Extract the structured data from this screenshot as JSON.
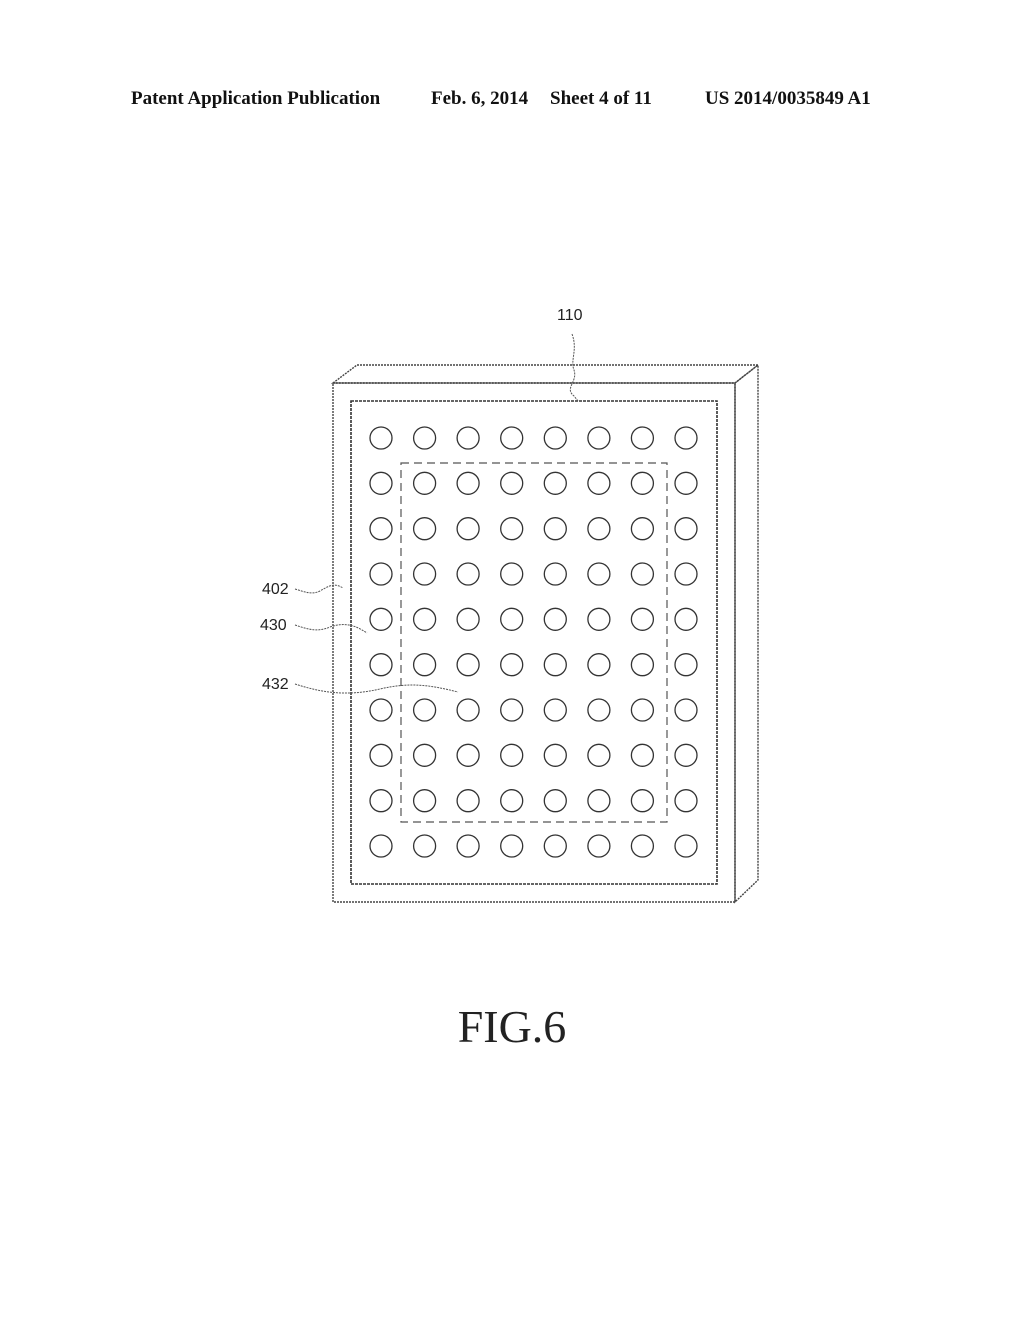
{
  "header": {
    "publication": "Patent Application Publication",
    "date": "Feb. 6, 2014",
    "sheet": "Sheet 4 of 11",
    "number": "US 2014/0035849 A1"
  },
  "figure": {
    "caption": "FIG.6",
    "grid": {
      "rows": 10,
      "columns": 8
    },
    "dashed_region": {
      "first_row": 2,
      "last_row": 9,
      "first_column": 2,
      "last_column": 7
    },
    "reference_labels": {
      "body": "110",
      "outer_area": "402",
      "array_area": "430",
      "inner_region": "432"
    }
  }
}
